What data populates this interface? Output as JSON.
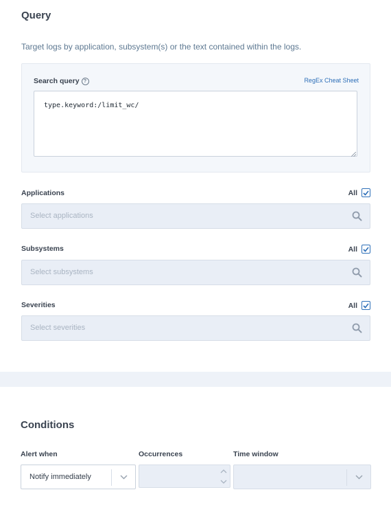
{
  "query": {
    "title": "Query",
    "description": "Target logs by application, subsystem(s) or the text contained within the logs.",
    "search_query_label": "Search query",
    "help_icon": "question-circle-icon",
    "cheat_sheet_link": "RegEx Cheat Sheet",
    "search_query_value": "type.keyword:/limit_wc/"
  },
  "filters": {
    "applications": {
      "label": "Applications",
      "all_label": "All",
      "all_checked": true,
      "placeholder": "Select applications"
    },
    "subsystems": {
      "label": "Subsystems",
      "all_label": "All",
      "all_checked": true,
      "placeholder": "Select subsystems"
    },
    "severities": {
      "label": "Severities",
      "all_label": "All",
      "all_checked": true,
      "placeholder": "Select severities"
    }
  },
  "conditions": {
    "title": "Conditions",
    "alert_when_label": "Alert when",
    "alert_when_value": "Notify immediately",
    "occurrences_label": "Occurrences",
    "occurrences_value": "",
    "time_window_label": "Time window",
    "time_window_value": ""
  },
  "colors": {
    "accent": "#2d6fb8",
    "field_disabled_bg": "#e9eef6",
    "section_divider": "#eef2f8"
  }
}
